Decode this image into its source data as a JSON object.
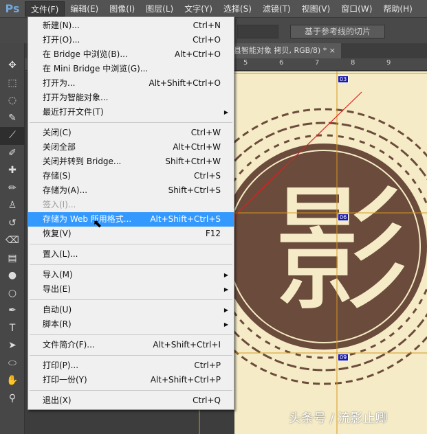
{
  "app": {
    "logo": "Ps"
  },
  "menubar": [
    "文件(F)",
    "编辑(E)",
    "图像(I)",
    "图层(L)",
    "文字(Y)",
    "选择(S)",
    "滤镜(T)",
    "视图(V)",
    "窗口(W)",
    "帮助(H)"
  ],
  "options": {
    "slice_button": "基于参考线的切片"
  },
  "doc_tab": {
    "title": "县智能对象 拷贝, RGB/8) *",
    "close": "×"
  },
  "ruler": [
    "5",
    "6",
    "7",
    "8",
    "9"
  ],
  "slices": [
    "03",
    "06",
    "09"
  ],
  "menu": [
    {
      "label": "新建(N)...",
      "shortcut": "Ctrl+N"
    },
    {
      "label": "打开(O)...",
      "shortcut": "Ctrl+O"
    },
    {
      "label": "在 Bridge 中浏览(B)...",
      "shortcut": "Alt+Ctrl+O"
    },
    {
      "label": "在 Mini Bridge 中浏览(G)...",
      "shortcut": ""
    },
    {
      "label": "打开为...",
      "shortcut": "Alt+Shift+Ctrl+O"
    },
    {
      "label": "打开为智能对象...",
      "shortcut": ""
    },
    {
      "label": "最近打开文件(T)",
      "shortcut": "",
      "submenu": true
    },
    {
      "sep": true
    },
    {
      "label": "关闭(C)",
      "shortcut": "Ctrl+W"
    },
    {
      "label": "关闭全部",
      "shortcut": "Alt+Ctrl+W"
    },
    {
      "label": "关闭并转到 Bridge...",
      "shortcut": "Shift+Ctrl+W"
    },
    {
      "label": "存储(S)",
      "shortcut": "Ctrl+S"
    },
    {
      "label": "存储为(A)...",
      "shortcut": "Shift+Ctrl+S"
    },
    {
      "label": "签入(I)...",
      "shortcut": "",
      "disabled": true
    },
    {
      "label": "存储为 Web 所用格式...",
      "shortcut": "Alt+Shift+Ctrl+S",
      "highlighted": true
    },
    {
      "label": "恢复(V)",
      "shortcut": "F12"
    },
    {
      "sep": true
    },
    {
      "label": "置入(L)...",
      "shortcut": ""
    },
    {
      "sep": true
    },
    {
      "label": "导入(M)",
      "shortcut": "",
      "submenu": true
    },
    {
      "label": "导出(E)",
      "shortcut": "",
      "submenu": true
    },
    {
      "sep": true
    },
    {
      "label": "自动(U)",
      "shortcut": "",
      "submenu": true
    },
    {
      "label": "脚本(R)",
      "shortcut": "",
      "submenu": true
    },
    {
      "sep": true
    },
    {
      "label": "文件简介(F)...",
      "shortcut": "Alt+Shift+Ctrl+I"
    },
    {
      "sep": true
    },
    {
      "label": "打印(P)...",
      "shortcut": "Ctrl+P"
    },
    {
      "label": "打印一份(Y)",
      "shortcut": "Alt+Shift+Ctrl+P"
    },
    {
      "sep": true
    },
    {
      "label": "退出(X)",
      "shortcut": "Ctrl+Q"
    }
  ],
  "watermark": "头条号 / 流影止卿",
  "colors": {
    "highlight": "#3399ff",
    "canvas_bg": "#f5ebc6",
    "seal": "#6b4b3b",
    "guide": "#d49a1e"
  }
}
